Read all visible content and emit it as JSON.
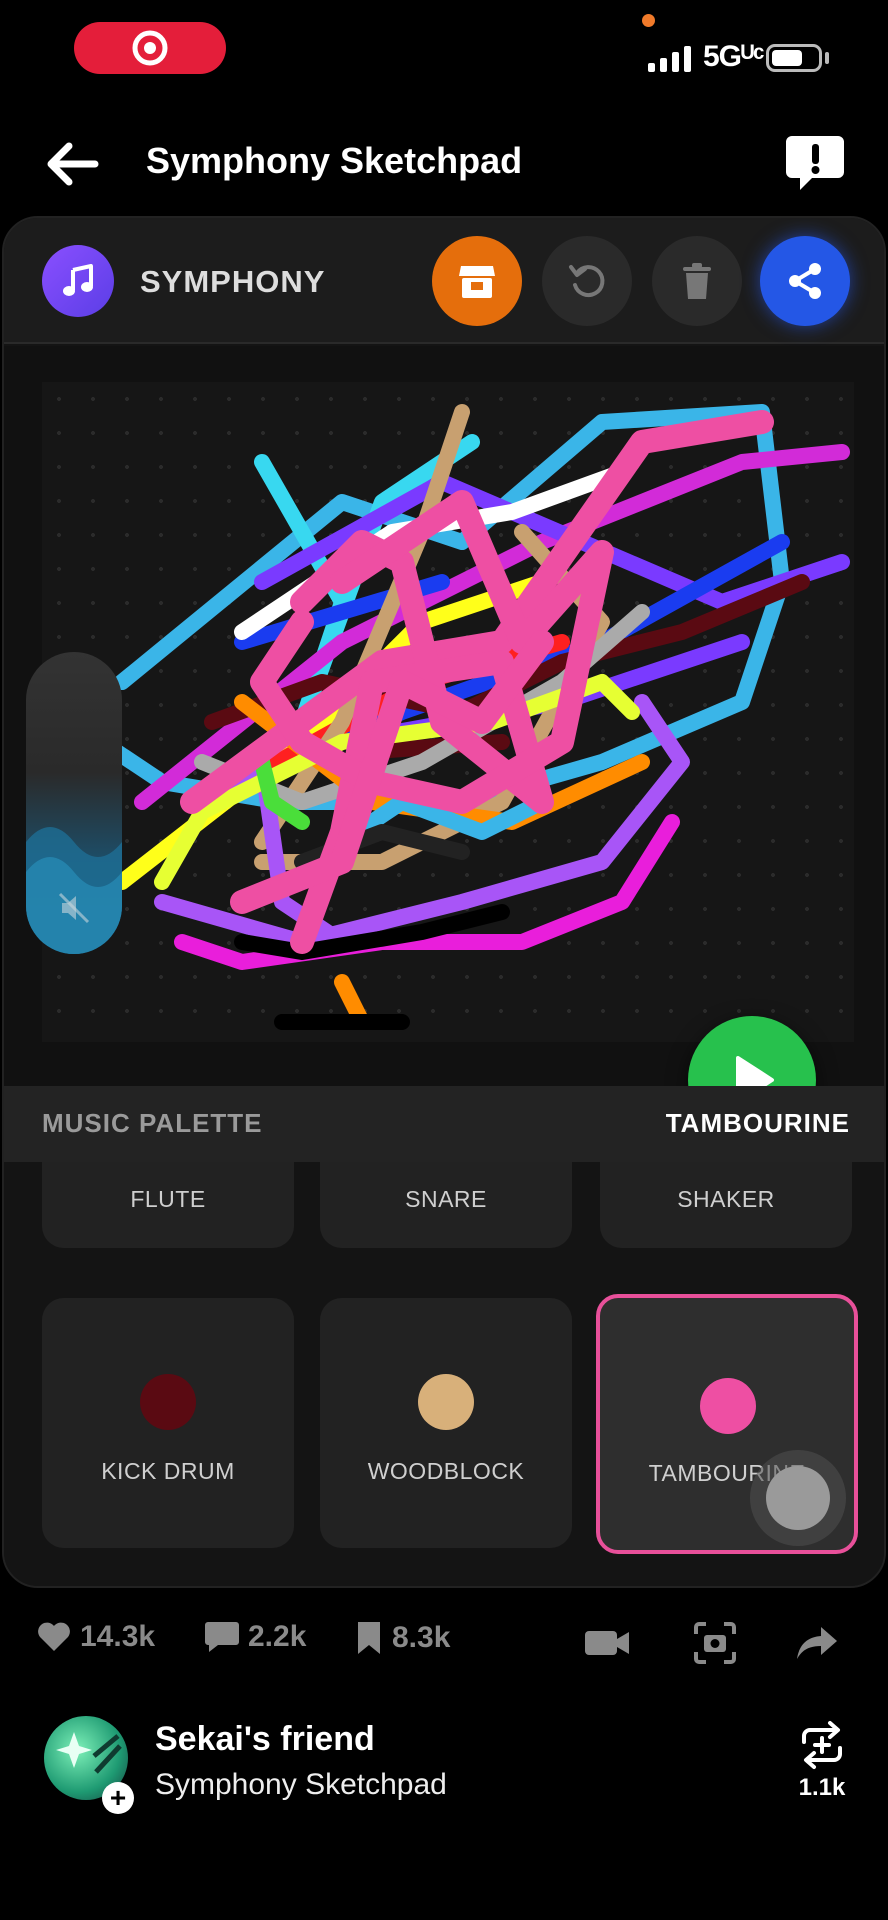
{
  "status_bar": {
    "network": "5Gᵁᶜ"
  },
  "header": {
    "title": "Symphony Sketchpad"
  },
  "toolbar": {
    "app_name": "SYMPHONY"
  },
  "palette": {
    "title": "MUSIC PALETTE",
    "selected": "TAMBOURINE",
    "instruments_top": [
      {
        "label": "FLUTE"
      },
      {
        "label": "SNARE"
      },
      {
        "label": "SHAKER"
      }
    ],
    "instruments_bottom": [
      {
        "label": "KICK DRUM",
        "color": "#5a0a12"
      },
      {
        "label": "WOODBLOCK",
        "color": "#d8b07a"
      },
      {
        "label": "TAMBOURINE",
        "color": "#ee4fa3"
      }
    ]
  },
  "stats": {
    "likes": "14.3k",
    "comments": "2.2k",
    "saves": "8.3k"
  },
  "creator": {
    "name": "Sekai's friend",
    "app": "Symphony Sketchpad",
    "remix_count": "1.1k"
  },
  "colors": {
    "accent_pink": "#e8509a",
    "play_green": "#27c14d",
    "share_blue": "#2457e6",
    "store_orange": "#e56e0c"
  }
}
